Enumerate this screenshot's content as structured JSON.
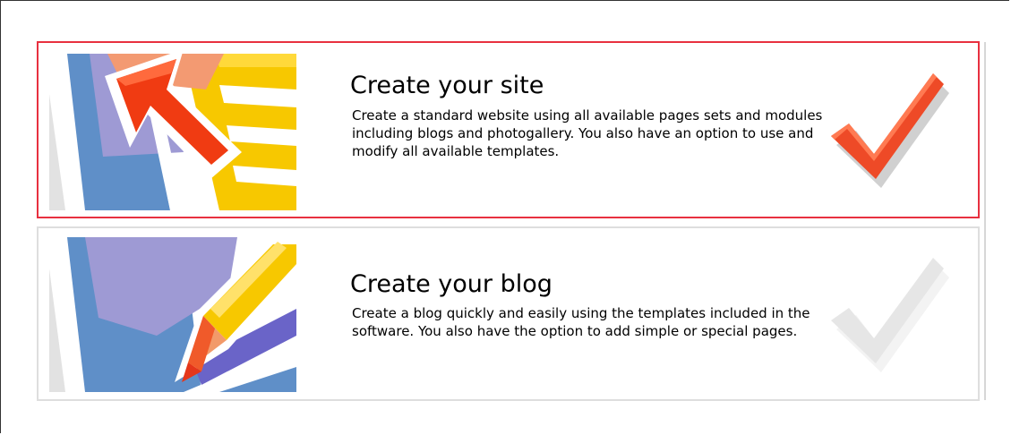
{
  "options": [
    {
      "title": "Create your site",
      "description": "Create a standard website using all available pages sets and modules including blogs and photogallery. You also have an option to use and modify all available templates.",
      "selected": true,
      "illustration": "site-arrow-illustration",
      "check_color": "#e8402a"
    },
    {
      "title": "Create your blog",
      "description": "Create a blog quickly and easily using the templates included in the software. You also have the option to add simple or special pages.",
      "selected": false,
      "illustration": "blog-pencil-illustration",
      "check_color": "#e6e6e6"
    }
  ],
  "colors": {
    "selected_border": "#e8303f",
    "unselected_border": "#dedede",
    "blue": "#5f8fc8",
    "purple": "#9b97d0",
    "yellow": "#f5c400",
    "red": "#e84a2a"
  }
}
